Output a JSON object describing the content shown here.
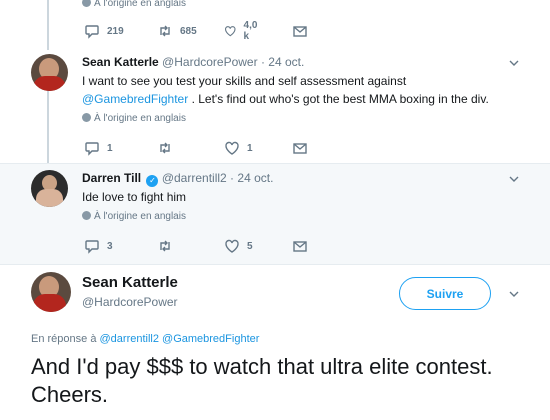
{
  "colors": {
    "accent": "#1da1f2",
    "link": "#1b95e0",
    "muted": "#657786",
    "thread_line": "#ccd6dd",
    "highlight_bg": "#f5f8fa"
  },
  "tweet0": {
    "translate_label": "À l'origine en anglais",
    "reply_count": "219",
    "retweet_count": "685",
    "like_count": "4,0 k"
  },
  "tweet1": {
    "name": "Sean Katterle",
    "handle": "@HardcorePower",
    "dot": "·",
    "date": "24 oct.",
    "text_part1": "I want to see you test your skills and self assessment against",
    "mention": "@GamebredFighter",
    "text_part2": ". Let's find out who's got the best MMA boxing in the div.",
    "translate_label": "À l'origine en anglais",
    "reply_count": "1",
    "retweet_count": "",
    "like_count": "1"
  },
  "tweet2": {
    "name": "Darren Till",
    "verified_glyph": "✓",
    "handle": "@darrentill2",
    "dot": "·",
    "date": "24 oct.",
    "text": "Ide love to fight him",
    "translate_label": "À l'origine en anglais",
    "reply_count": "3",
    "retweet_count": "",
    "like_count": "5"
  },
  "main_tweet": {
    "name": "Sean Katterle",
    "handle": "@HardcorePower",
    "follow_label": "Suivre",
    "reply_prefix": "En réponse à",
    "reply_mention1": "@darrentill2",
    "reply_mention2": "@GamebredFighter",
    "text": "And I'd pay $$$ to watch that ultra elite contest. Cheers."
  },
  "icons": {
    "reply": "reply-icon",
    "retweet": "retweet-icon",
    "like": "heart-icon",
    "dm": "envelope-icon",
    "caret": "chevron-down-icon",
    "translate": "globe-icon"
  }
}
